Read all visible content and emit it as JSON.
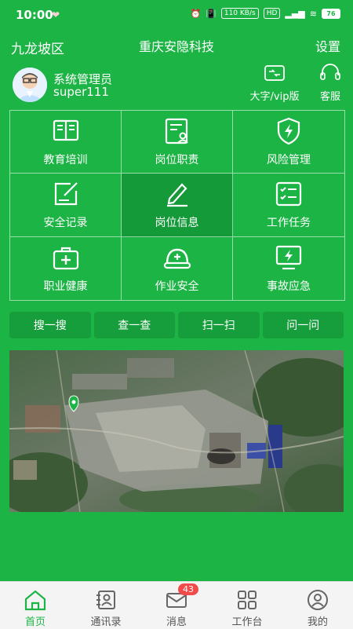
{
  "status": {
    "time": "10:00",
    "net_speed": "110 KB/s",
    "hd": "HD",
    "battery": "76"
  },
  "header": {
    "region": "九龙坡区",
    "company": "重庆安隐科技",
    "settings": "设置"
  },
  "user": {
    "role": "系统管理员",
    "id": "super111"
  },
  "quick": {
    "bigfont_label": "大字/vip版",
    "service_label": "客服"
  },
  "modules": [
    {
      "label": "教育培训",
      "icon": "book-icon"
    },
    {
      "label": "岗位职责",
      "icon": "duty-card-icon"
    },
    {
      "label": "风险管理",
      "icon": "shield-bolt-icon"
    },
    {
      "label": "安全记录",
      "icon": "edit-record-icon"
    },
    {
      "label": "岗位信息",
      "icon": "pencil-line-icon"
    },
    {
      "label": "工作任务",
      "icon": "checklist-icon"
    },
    {
      "label": "职业健康",
      "icon": "medical-kit-icon"
    },
    {
      "label": "作业安全",
      "icon": "helmet-icon"
    },
    {
      "label": "事故应急",
      "icon": "monitor-bolt-icon"
    }
  ],
  "actions": [
    "搜一搜",
    "查一查",
    "扫一扫",
    "问一问"
  ],
  "tabs": [
    {
      "label": "首页",
      "icon": "home-icon"
    },
    {
      "label": "通讯录",
      "icon": "contacts-icon"
    },
    {
      "label": "消息",
      "icon": "mail-icon",
      "badge": "43"
    },
    {
      "label": "工作台",
      "icon": "workbench-icon"
    },
    {
      "label": "我的",
      "icon": "profile-icon"
    }
  ],
  "colors": {
    "primary": "#1db446",
    "active_cell": "#159a3a",
    "badge": "#f04a4a"
  }
}
